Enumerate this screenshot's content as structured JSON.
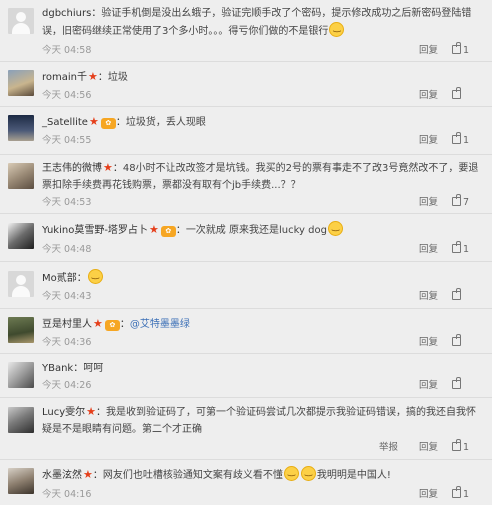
{
  "actions": {
    "reply": "回复",
    "report": "举报"
  },
  "comments": [
    {
      "name": "dgbchiurs",
      "vip": false,
      "badge": false,
      "text": "验证手机倒是没出幺蛾子，验证完顺手改了个密码，提示修改成功之后新密码登陆错误，旧密码继续正常使用了3个多小时。。。得亏你们做的不是银行",
      "time": "今天 04:58",
      "likes": "1"
    },
    {
      "name": "romain千",
      "vip": true,
      "badge": false,
      "text": "垃圾",
      "time": "今天 04:56",
      "likes": ""
    },
    {
      "name": "_Satellite",
      "vip": true,
      "badge": true,
      "text": "垃圾货，丢人现眼",
      "time": "今天 04:55",
      "likes": "1"
    },
    {
      "name": "王志伟的微博",
      "vip": true,
      "badge": false,
      "text": "48小时不让改改签才是坑钱。我买的2号的票有事走不了改3号竟然改不了，要退票扣除手续费再花钱购票，票都没有取有个jb手续费...？？",
      "time": "今天 04:53",
      "likes": "7"
    },
    {
      "name": "Yukino莫雪野-塔罗占卜",
      "vip": true,
      "badge": true,
      "text": "一次就成 原来我还是lucky dog",
      "time": "今天 04:48",
      "likes": "1"
    },
    {
      "name": "Mo贰部",
      "vip": false,
      "badge": false,
      "text": "",
      "time": "今天 04:43",
      "likes": ""
    },
    {
      "name": "豆是村里人",
      "vip": true,
      "badge": true,
      "text": "",
      "mention": "@艾特墨墨绿",
      "time": "今天 04:36",
      "likes": ""
    },
    {
      "name": "YBank",
      "vip": false,
      "badge": false,
      "text": "呵呵",
      "time": "今天 04:26",
      "likes": ""
    },
    {
      "name": "Lucy雯尔",
      "vip": true,
      "badge": false,
      "text": "我是收到验证码了，可第一个验证码尝试几次都提示我验证码错误，搞的我还自我怀疑是不是眼睛有问题。第二个才正确",
      "time": "今天 04:22",
      "likes": "1"
    },
    {
      "name": "水墨泫然",
      "vip": true,
      "badge": false,
      "text": "网友们也吐槽核验通知文案有歧义看不懂",
      "text_after": "我明明是中国人!",
      "time": "今天 04:16",
      "likes": "1"
    }
  ]
}
